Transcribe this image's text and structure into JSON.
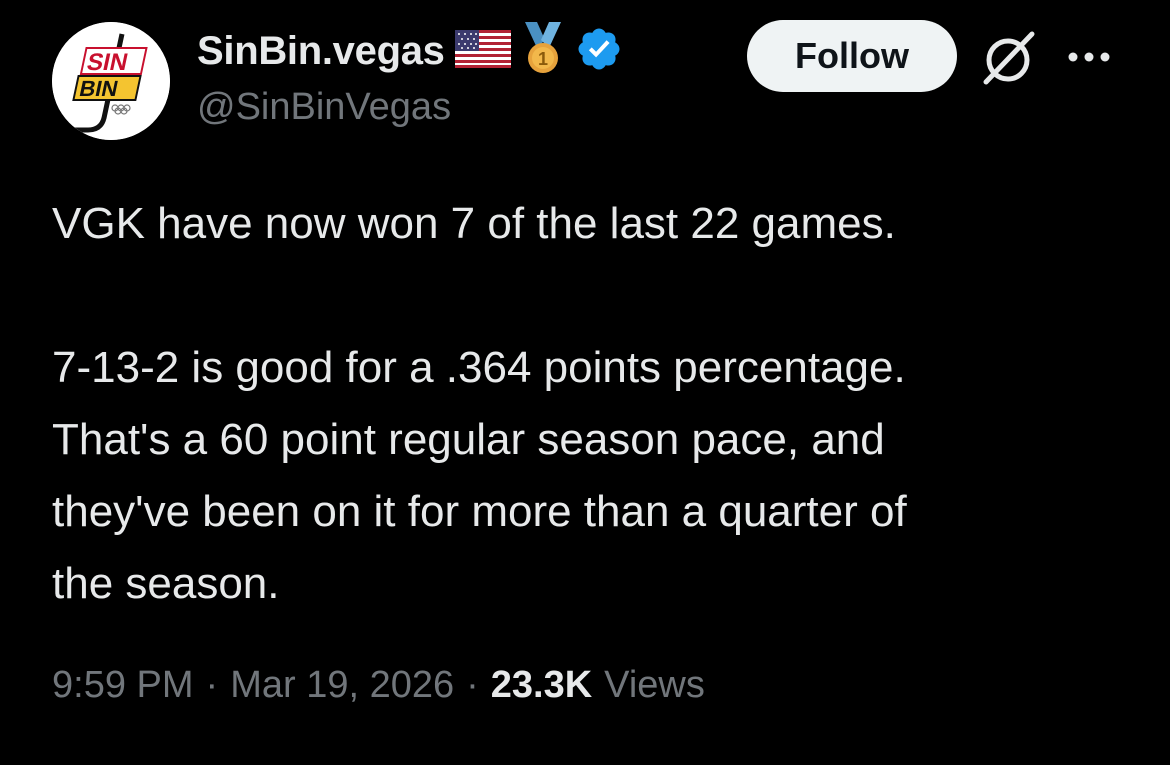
{
  "author": {
    "display_name": "SinBin.vegas",
    "handle": "@SinBinVegas",
    "avatar_icon": "sinbin-logo",
    "avatar_logo_text_top": "SIN",
    "avatar_logo_text_bottom": "BIN",
    "badges": [
      "us-flag-icon",
      "gold-medal-icon",
      "verified-badge-icon"
    ],
    "medal_number": "1",
    "verified_color": "#1d9bf0"
  },
  "actions": {
    "follow_label": "Follow",
    "grok_icon": "grok-icon",
    "more_icon": "more-options-icon"
  },
  "tweet": {
    "paragraphs": [
      "VGK have now won 7 of the last 22 games.",
      "7-13-2 is good for a .364 points percentage.",
      "That's a 60 point regular season pace, and",
      "they've been on it for more than a quarter of",
      "the season."
    ]
  },
  "meta": {
    "time": "9:59 PM",
    "date": "Mar 19, 2026",
    "views_count": "23.3K",
    "views_label": "Views",
    "separator": "·"
  },
  "colors": {
    "background": "#000000",
    "text_primary": "#e7e9ea",
    "text_secondary": "#71767b",
    "follow_bg": "#eff3f4",
    "verified": "#1d9bf0",
    "medal_gold": "#e6a23c"
  }
}
